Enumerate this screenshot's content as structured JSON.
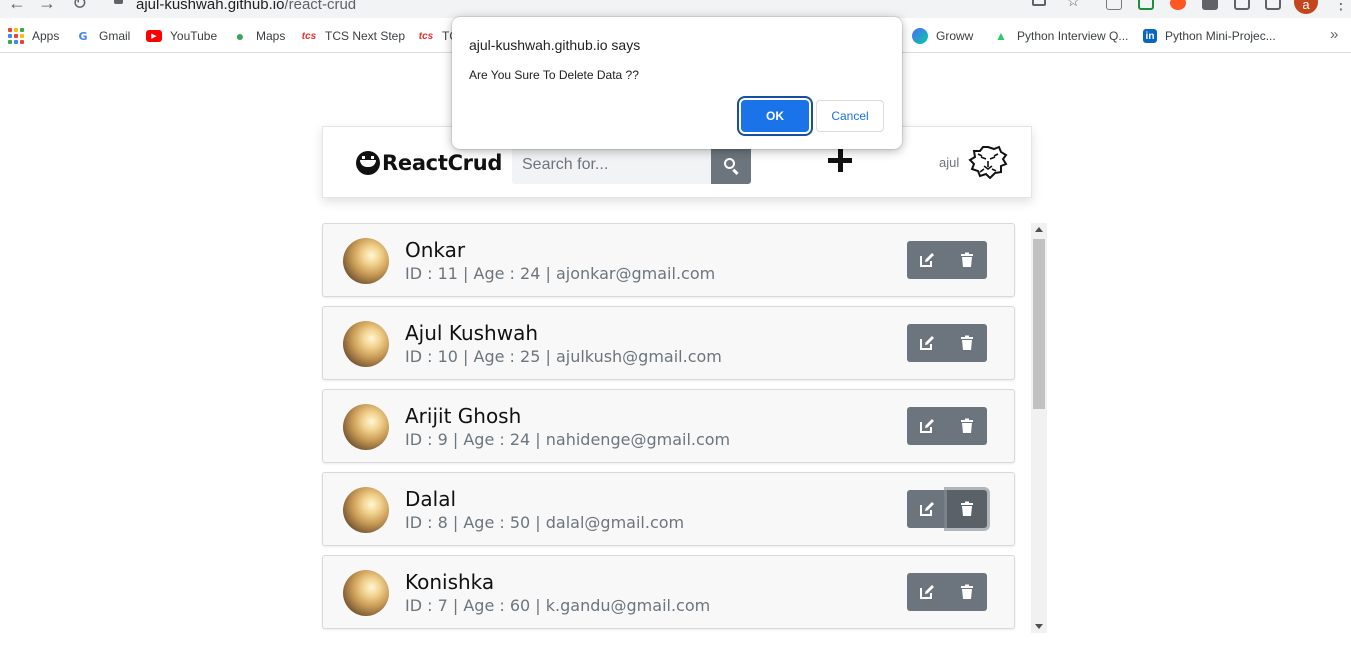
{
  "browser": {
    "url_host": "ajul-kushwah.github.io",
    "url_path": "/react-crud",
    "profile_initial": "a",
    "bookmarks": [
      {
        "label": "Apps",
        "icon": "apps-grid-icon"
      },
      {
        "label": "Gmail",
        "icon": "google-icon"
      },
      {
        "label": "YouTube",
        "icon": "youtube-icon"
      },
      {
        "label": "Maps",
        "icon": "maps-pin-icon"
      },
      {
        "label": "TCS Next Step",
        "icon": "tcs-icon"
      },
      {
        "label": "TC",
        "icon": "tcs-icon"
      },
      {
        "label": "Groww",
        "icon": "groww-icon"
      },
      {
        "label": "Python Interview Q...",
        "icon": "hackerrank-icon"
      },
      {
        "label": "Python Mini-Projec...",
        "icon": "linkedin-icon"
      }
    ]
  },
  "dialog": {
    "title": "ajul-kushwah.github.io says",
    "message": "Are You Sure To Delete Data ??",
    "ok_label": "OK",
    "cancel_label": "Cancel"
  },
  "header": {
    "brand": "ReactCrud",
    "search_placeholder": "Search for...",
    "user_name": "ajul"
  },
  "records": [
    {
      "name": "Onkar",
      "info": "ID : 11 | Age : 24 | ajonkar@gmail.com"
    },
    {
      "name": "Ajul Kushwah",
      "info": "ID : 10 | Age : 25 | ajulkush@gmail.com"
    },
    {
      "name": "Arijit Ghosh",
      "info": "ID : 9 | Age : 24 | nahidenge@gmail.com"
    },
    {
      "name": "Dalal",
      "info": "ID : 8 | Age : 50 | dalal@gmail.com"
    },
    {
      "name": "Konishka",
      "info": "ID : 7 | Age : 60 | k.gandu@gmail.com"
    }
  ],
  "colors": {
    "primary_button": "#1a73e8",
    "secondary_button": "#6c757d",
    "card_background": "#f8f8f8"
  }
}
